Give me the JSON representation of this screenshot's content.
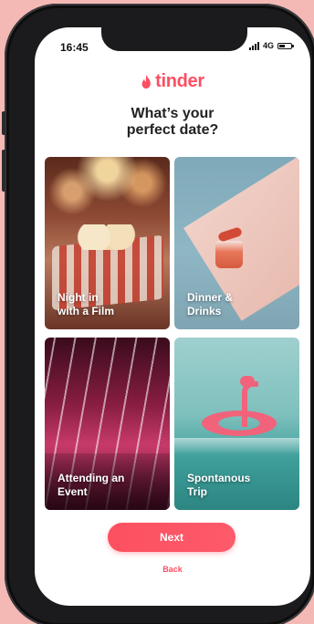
{
  "status_bar": {
    "time": "16:45",
    "network": "4G"
  },
  "brand": {
    "name": "tinder",
    "color": "#fd4f62"
  },
  "screen": {
    "question": "What’s your\nperfect date?"
  },
  "options": [
    {
      "label": "Night in\nwith a Film"
    },
    {
      "label": "Dinner &\nDrinks"
    },
    {
      "label": "Attending an\nEvent"
    },
    {
      "label": "Spontanous\nTrip"
    }
  ],
  "actions": {
    "next_label": "Next",
    "back_label": "Back"
  },
  "icons": {
    "logo": "flame-icon",
    "signal": "signal-icon",
    "battery": "battery-icon"
  }
}
